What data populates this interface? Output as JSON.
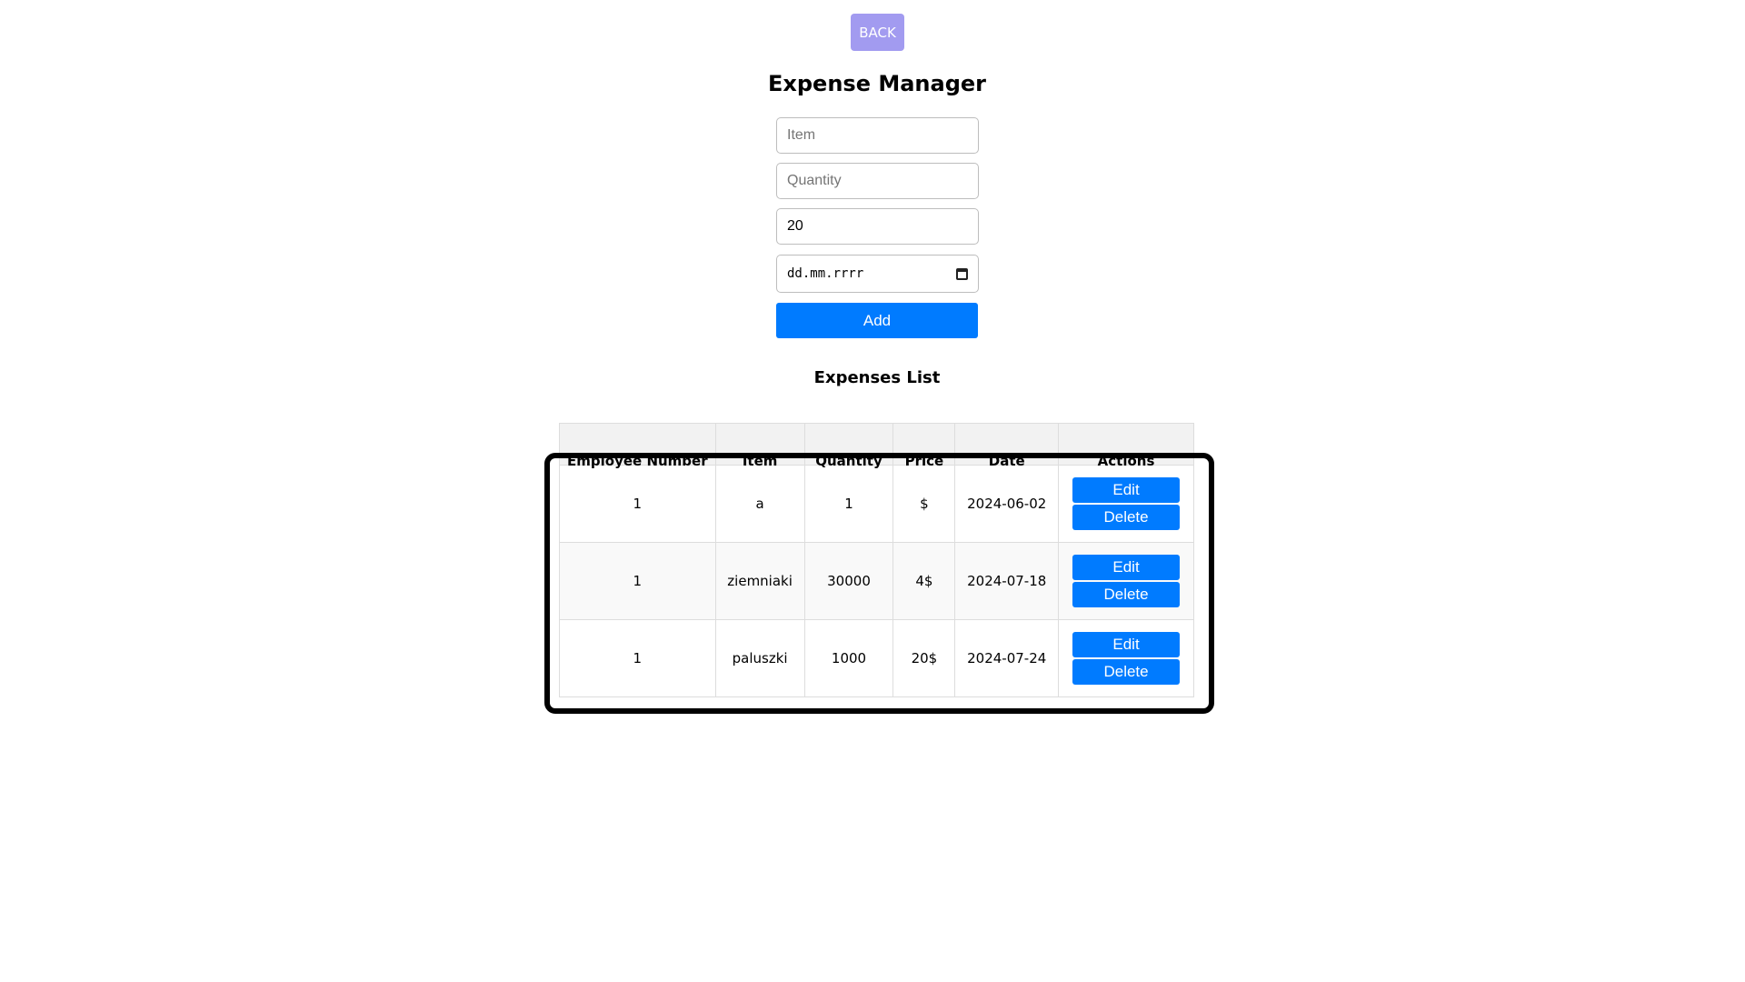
{
  "back_label": "BACK",
  "title": "Expense Manager",
  "form": {
    "item_placeholder": "Item",
    "quantity_placeholder": "Quantity",
    "price_value": "20",
    "date_placeholder": "dd.mm.rrrr",
    "add_label": "Add"
  },
  "list_title": "Expenses List",
  "table": {
    "columns": [
      "Employee Number",
      "Item",
      "Quantity",
      "Price",
      "Date",
      "Actions"
    ],
    "rows": [
      {
        "employee": "1",
        "item": "a",
        "quantity": "1",
        "price": "$",
        "date": "2024-06-02"
      },
      {
        "employee": "1",
        "item": "ziemniaki",
        "quantity": "30000",
        "price": "4$",
        "date": "2024-07-18"
      },
      {
        "employee": "1",
        "item": "paluszki",
        "quantity": "1000",
        "price": "20$",
        "date": "2024-07-24"
      }
    ],
    "edit_label": "Edit",
    "delete_label": "Delete"
  },
  "colors": {
    "back_button": "#a29bf0",
    "primary": "#007bff",
    "header_bg": "#f2f2f2"
  }
}
